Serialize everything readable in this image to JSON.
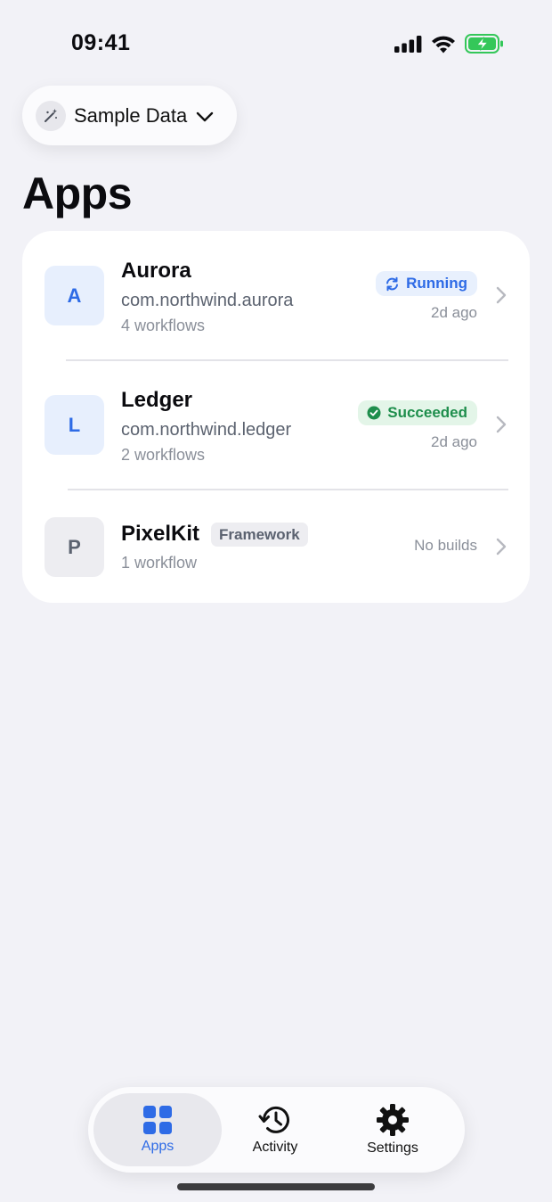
{
  "status_bar": {
    "time": "09:41"
  },
  "data_source": {
    "label": "Sample Data"
  },
  "page": {
    "title": "Apps"
  },
  "apps": [
    {
      "initial": "A",
      "name": "Aurora",
      "bundle_id": "com.northwind.aurora",
      "workflows": "4 workflows",
      "status": "Running",
      "last_build": "2d ago"
    },
    {
      "initial": "L",
      "name": "Ledger",
      "bundle_id": "com.northwind.ledger",
      "workflows": "2 workflows",
      "status": "Succeeded",
      "last_build": "2d ago"
    },
    {
      "initial": "P",
      "name": "PixelKit",
      "tag": "Framework",
      "workflows": "1 workflow",
      "last_build": "No builds"
    }
  ],
  "tabs": [
    {
      "label": "Apps",
      "icon": "grid-icon",
      "active": true
    },
    {
      "label": "Activity",
      "icon": "history-icon",
      "active": false
    },
    {
      "label": "Settings",
      "icon": "gear-icon",
      "active": false
    }
  ],
  "colors": {
    "accent": "#2E6BE6",
    "success": "#1E8E4C",
    "background": "#F2F2F7"
  }
}
